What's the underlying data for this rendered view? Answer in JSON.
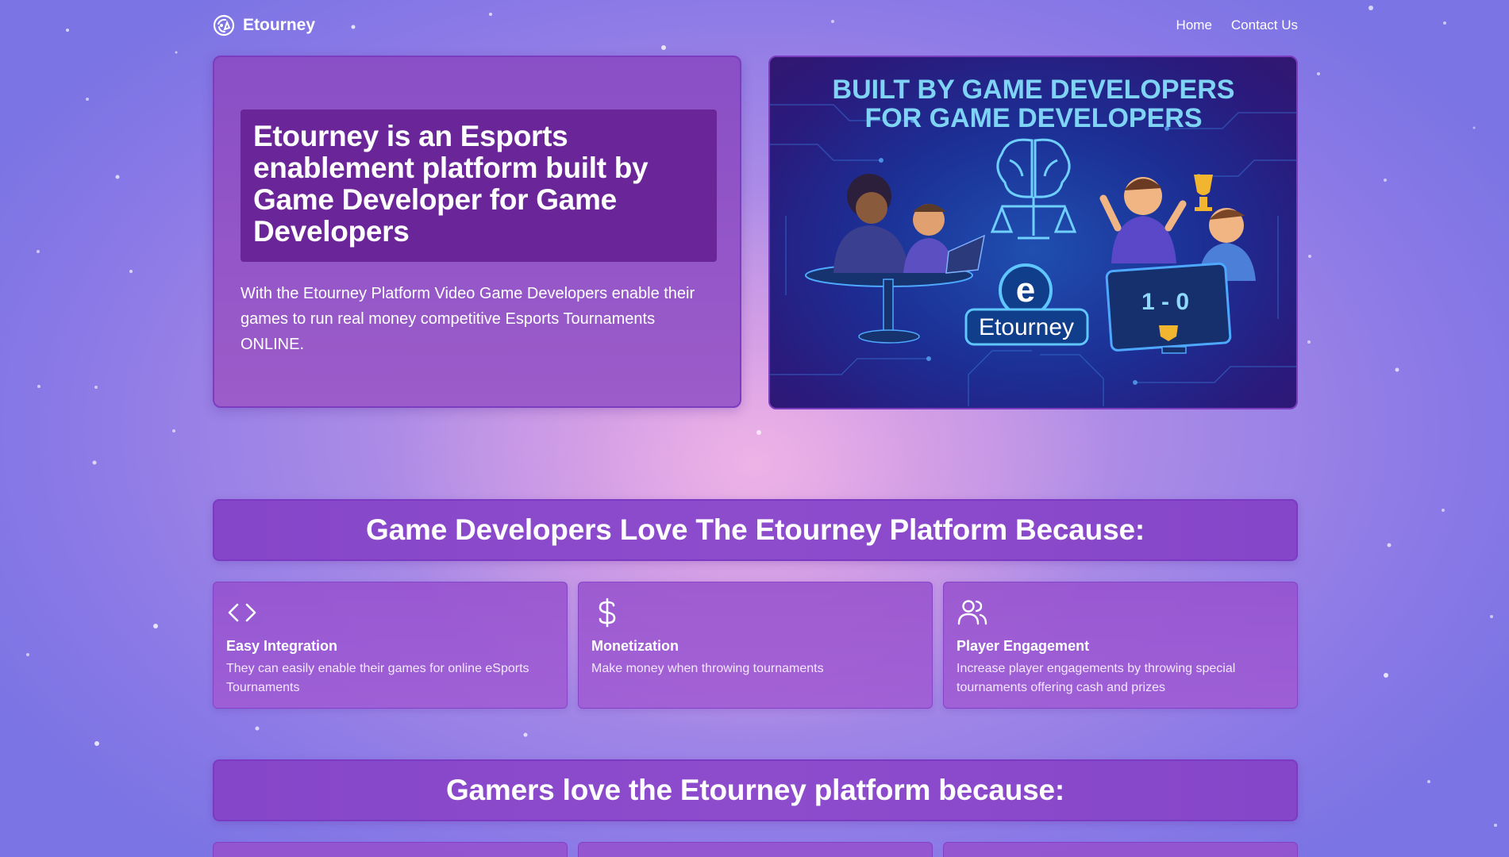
{
  "nav": {
    "brand": "Etourney",
    "links": [
      "Home",
      "Contact Us"
    ]
  },
  "hero": {
    "title": "Etourney is an Esports enablement platform built by Game Developer for Game Developers",
    "description": "With the Etourney Platform Video Game Developers enable their games to run real money competitive Esports Tournaments ONLINE.",
    "image": {
      "headline_line1": "BUILT BY GAME DEVELOPERS",
      "headline_line2": "FOR GAME DEVELOPERS",
      "logo_letter": "e",
      "logo_text": "Etourney",
      "score": "1 - 0"
    }
  },
  "section_developers": {
    "heading": "Game Developers Love The Etourney Platform Because:",
    "features": [
      {
        "icon": "code-icon",
        "title": "Easy Integration",
        "text": "They can easily enable their games for online eSports Tournaments"
      },
      {
        "icon": "dollar-icon",
        "title": "Monetization",
        "text": "Make money when throwing tournaments"
      },
      {
        "icon": "users-icon",
        "title": "Player Engagement",
        "text": "Increase player engagements by throwing special tournaments offering cash and prizes"
      }
    ]
  },
  "section_gamers": {
    "heading": "Gamers love the Etourney platform because:"
  },
  "colors": {
    "accent": "#8646c9",
    "title_box": "#6a2598",
    "image_headline": "#7fd3f5"
  }
}
